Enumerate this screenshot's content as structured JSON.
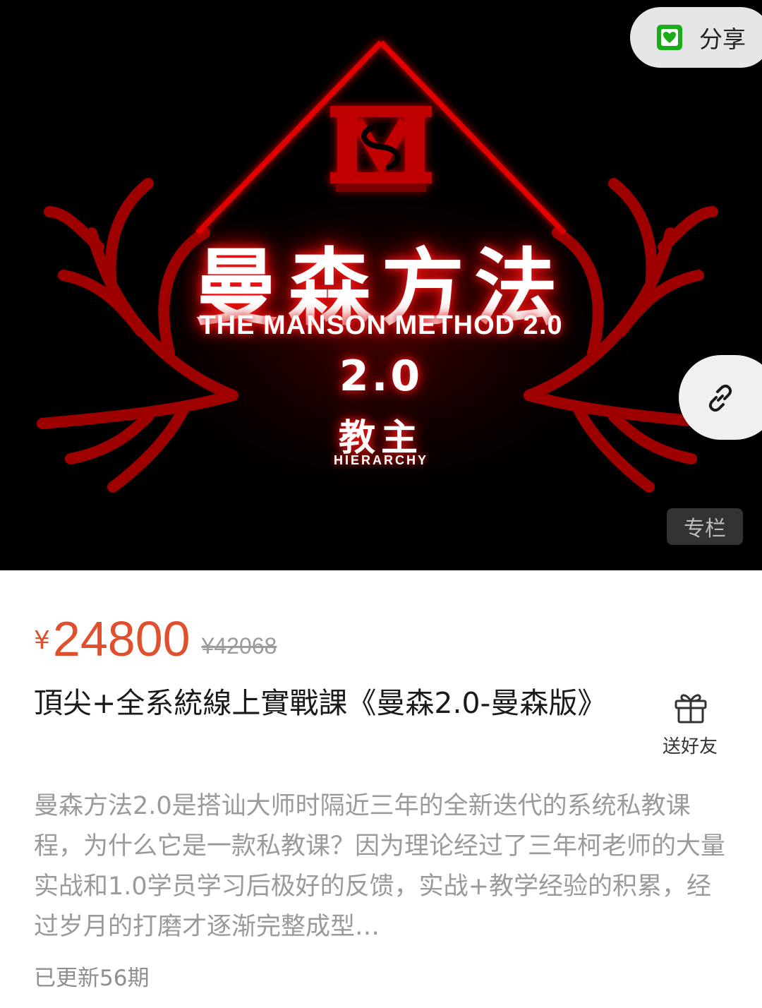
{
  "cover": {
    "logo_mark": "MS",
    "title_cn": "曼森方法",
    "title_en": "THE MANSON METHOD 2.0",
    "version": "2.0",
    "tier_cn": "教主",
    "tier_en": "HIERARCHY",
    "column_tag": "专栏"
  },
  "share": {
    "label": "分享",
    "icon": "wechat-share-icon"
  },
  "link_button": {
    "icon": "link-icon"
  },
  "price": {
    "symbol": "¥",
    "current": "24800",
    "original": "¥42068",
    "color": "#e0502f"
  },
  "course": {
    "title": "頂尖+全系統線上實戰課《曼森2.0-曼森版》",
    "description": "曼森方法2.0是搭讪大师时隔近三年的全新迭代的系统私教课程，为什么它是一款私教课？因为理论经过了三年柯老师的大量实战和1.0学员学习后极好的反馈，实战+教学经验的积累，经过岁月的打磨才逐渐完整成型…",
    "updated": "已更新56期"
  },
  "gift": {
    "label": "送好友",
    "icon": "gift-icon"
  },
  "colors": {
    "cover_bg": "#000000",
    "accent_red": "#e00000",
    "price_red": "#e0502f"
  }
}
